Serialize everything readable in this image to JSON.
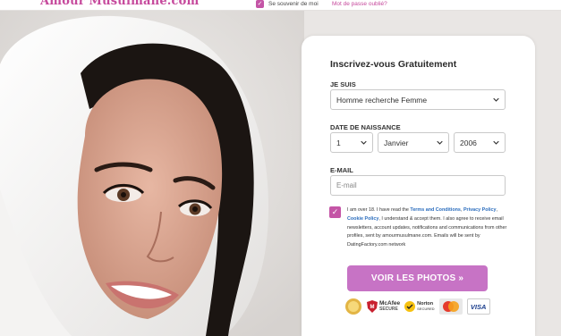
{
  "header": {
    "logo_text": "Amour Musulmane.com",
    "remember_me_label": "Se souvenir de moi",
    "forgot_password_link": "Mot de passe oublié?"
  },
  "form": {
    "title": "Inscrivez-vous Gratuitement",
    "je_suis_label": "JE SUIS",
    "je_suis_value": "Homme recherche Femme",
    "birthdate_label": "DATE DE NAISSANCE",
    "day_value": "1",
    "month_value": "Janvier",
    "year_value": "2006",
    "email_label": "E-MAIL",
    "email_placeholder": "E-mail",
    "consent": {
      "checked": true,
      "text_1": "I am over 18. I have read the ",
      "terms_link": "Terms and Conditions",
      "text_2": ", ",
      "privacy_link": "Privacy Policy",
      "text_3": ", ",
      "cookie_link": "Cookie Policy",
      "text_4": ", I understand & accept them. I also agree to receive email newsletters, account updates, notifications and communications from other profiles, sent by amourmusulmane.com. Emails will be sent by DatingFactory.com network"
    },
    "submit_label": "VOIR LES PHOTOS »"
  },
  "trust_badges": {
    "mcafee_line1": "McAfee",
    "mcafee_line2": "SECURE",
    "norton_line1": "Norton",
    "norton_line2": "SECURED",
    "visa": "VISA"
  },
  "colors": {
    "brand_pink": "#c455a6",
    "button_pink": "#c773c5",
    "link_blue": "#2b6dbd"
  }
}
